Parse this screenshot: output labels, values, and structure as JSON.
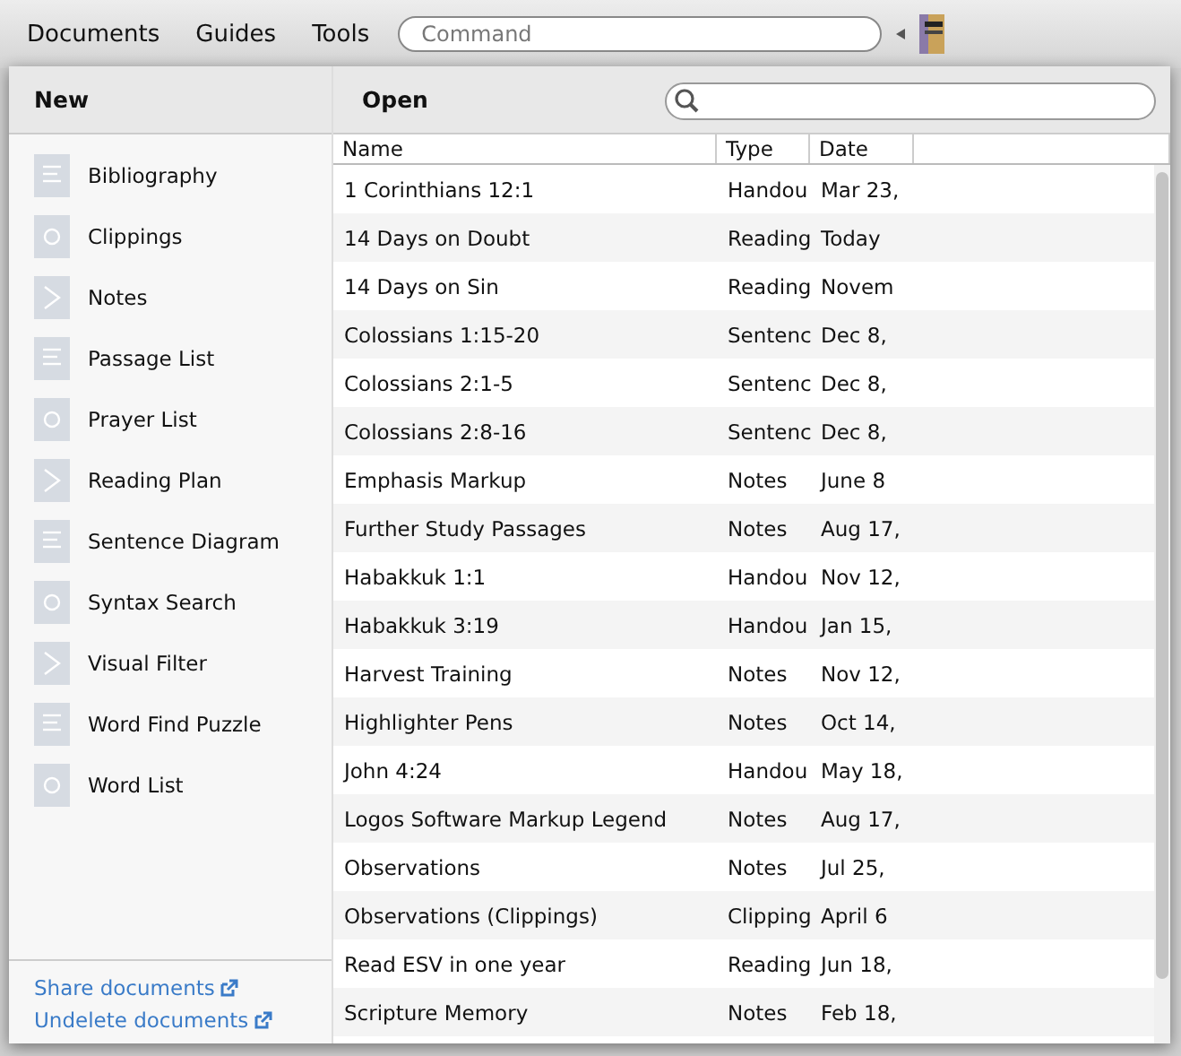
{
  "menu": [
    "Documents",
    "Guides",
    "Tools"
  ],
  "command": {
    "placeholder": "Command"
  },
  "new_panel": {
    "title": "New",
    "items": [
      {
        "label": "Bibliography"
      },
      {
        "label": "Clippings"
      },
      {
        "label": "Notes"
      },
      {
        "label": "Passage List"
      },
      {
        "label": "Prayer List"
      },
      {
        "label": "Reading Plan"
      },
      {
        "label": "Sentence Diagram"
      },
      {
        "label": "Syntax Search"
      },
      {
        "label": "Visual Filter"
      },
      {
        "label": "Word Find Puzzle"
      },
      {
        "label": "Word List"
      }
    ],
    "links": [
      "Share documents",
      "Undelete documents"
    ]
  },
  "open_panel": {
    "title": "Open",
    "columns": [
      "Name",
      "Type",
      "Date"
    ],
    "rows": [
      {
        "name": "1 Corinthians 12:1",
        "type": "Handou",
        "date": "Mar 23,"
      },
      {
        "name": "14 Days on Doubt",
        "type": "Reading",
        "date": "Today"
      },
      {
        "name": "14 Days on Sin",
        "type": "Reading",
        "date": "Novem"
      },
      {
        "name": "Colossians 1:15-20",
        "type": "Sentenc",
        "date": "Dec 8,"
      },
      {
        "name": "Colossians 2:1-5",
        "type": "Sentenc",
        "date": "Dec 8,"
      },
      {
        "name": "Colossians 2:8-16",
        "type": "Sentenc",
        "date": "Dec 8,"
      },
      {
        "name": "Emphasis Markup",
        "type": "Notes",
        "date": "June 8"
      },
      {
        "name": "Further Study Passages",
        "type": "Notes",
        "date": "Aug 17,"
      },
      {
        "name": "Habakkuk 1:1",
        "type": "Handou",
        "date": "Nov 12,"
      },
      {
        "name": "Habakkuk 3:19",
        "type": "Handou",
        "date": "Jan 15,"
      },
      {
        "name": "Harvest Training",
        "type": "Notes",
        "date": "Nov 12,"
      },
      {
        "name": "Highlighter Pens",
        "type": "Notes",
        "date": "Oct 14,"
      },
      {
        "name": "John 4:24",
        "type": "Handou",
        "date": "May 18,"
      },
      {
        "name": "Logos Software Markup Legend",
        "type": "Notes",
        "date": "Aug 17,"
      },
      {
        "name": "Observations",
        "type": "Notes",
        "date": "Jul 25,"
      },
      {
        "name": "Observations (Clippings)",
        "type": "Clipping",
        "date": "April 6"
      },
      {
        "name": "Read ESV in one year",
        "type": "Reading",
        "date": "Jun 18,"
      },
      {
        "name": "Scripture Memory",
        "type": "Notes",
        "date": "Feb 18,"
      }
    ]
  }
}
